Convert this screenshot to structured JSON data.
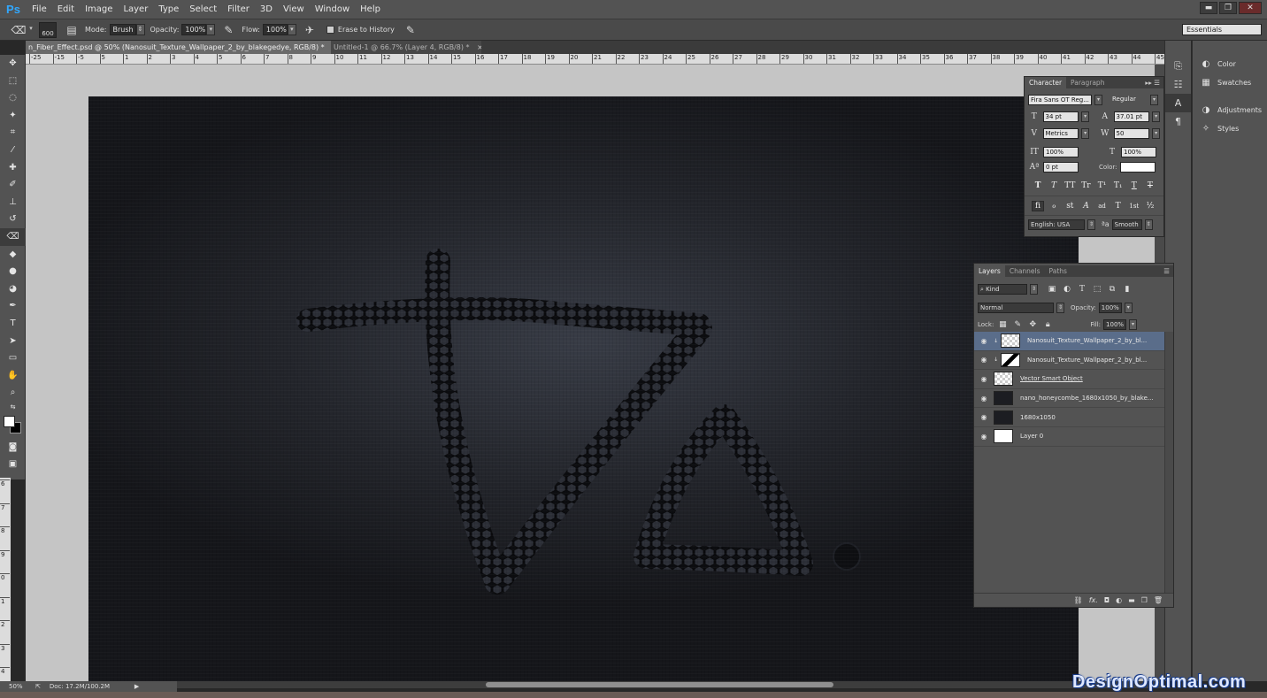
{
  "app": {
    "logo": "Ps"
  },
  "menu": [
    "File",
    "Edit",
    "Image",
    "Layer",
    "Type",
    "Select",
    "Filter",
    "3D",
    "View",
    "Window",
    "Help"
  ],
  "window_buttons": {
    "minimize": "▬",
    "restore": "❐",
    "close": "✕"
  },
  "options": {
    "brush_size": "600",
    "mode_label": "Mode:",
    "mode_value": "Brush",
    "opacity_label": "Opacity:",
    "opacity_value": "100%",
    "flow_label": "Flow:",
    "flow_value": "100%",
    "erase_history_label": "Erase to History",
    "workspace": "Essentials"
  },
  "doc_tabs": [
    {
      "label": "n_Fiber_Effect.psd @ 50% (Nanosuit_Texture_Wallpaper_2_by_blakegedye, RGB/8) *",
      "close": "×"
    },
    {
      "label": "Untitled-1 @ 66.7% (Layer 4, RGB/8) *",
      "close": "×"
    }
  ],
  "ruler_top": [
    "-25",
    "-15",
    "-5",
    "5",
    "1",
    "2",
    "3",
    "4",
    "5",
    "6",
    "7",
    "8",
    "9",
    "10",
    "11",
    "12",
    "13",
    "14",
    "15",
    "16",
    "17",
    "18",
    "19",
    "20",
    "21",
    "22",
    "23",
    "24",
    "25",
    "26",
    "27",
    "28",
    "29",
    "30",
    "31",
    "32",
    "33",
    "34",
    "35",
    "36",
    "37",
    "38",
    "39",
    "40",
    "41",
    "42",
    "43",
    "44",
    "45"
  ],
  "ruler_left": [
    "6",
    "7",
    "8",
    "9",
    "0",
    "1",
    "2",
    "3",
    "4",
    "5"
  ],
  "status": {
    "zoom": "50%",
    "doc": "Doc: 17.2M/100.2M"
  },
  "dock_panels": [
    {
      "label": "Color",
      "icon": "color-wheel-icon"
    },
    {
      "label": "Swatches",
      "icon": "swatches-icon"
    },
    {
      "label": "Adjustments",
      "icon": "adjustments-icon"
    },
    {
      "label": "Styles",
      "icon": "styles-icon"
    }
  ],
  "character": {
    "tabs": [
      "Character",
      "Paragraph"
    ],
    "font_family": "Fira Sans OT Reg...",
    "font_style": "Regular",
    "font_size": "34 pt",
    "leading": "37.01 pt",
    "kerning": "Metrics",
    "tracking": "50",
    "vertical_scale": "100%",
    "horizontal_scale": "100%",
    "baseline_shift": "0 pt",
    "color_label": "Color:",
    "color_value": "#ffffff",
    "style_glyphs": [
      "T",
      "T",
      "TT",
      "Tr",
      "T¹",
      "T₁",
      "T",
      "T"
    ],
    "opentype_glyphs": [
      "fi",
      "ℴ",
      "st",
      "A",
      "ad",
      "T",
      "1st",
      "½"
    ],
    "language": "English: USA",
    "aa_label": "ªa",
    "antialias": "Smooth"
  },
  "layers": {
    "tabs": [
      "Layers",
      "Channels",
      "Paths"
    ],
    "filter_kind": "Kind",
    "blend_mode": "Normal",
    "opacity_label": "Opacity:",
    "opacity": "100%",
    "lock_label": "Lock:",
    "fill_label": "Fill:",
    "fill": "100%",
    "items": [
      {
        "name": "Nanosuit_Texture_Wallpaper_2_by_bl...",
        "selected": true
      },
      {
        "name": "Nanosuit_Texture_Wallpaper_2_by_bl...",
        "selected": false
      },
      {
        "name": "Vector Smart Object",
        "selected": false
      },
      {
        "name": "nano_honeycombe_1680x1050_by_blake...",
        "selected": false
      },
      {
        "name": "1680x1050",
        "selected": false
      },
      {
        "name": "Layer 0",
        "selected": false
      }
    ],
    "footer_icons": [
      "link-icon",
      "fx-icon",
      "mask-icon",
      "adjustment-layer-icon",
      "group-folder-icon",
      "new-layer-icon",
      "trash-icon"
    ]
  },
  "colors": {
    "accent_blue": "#31a8ff",
    "layer_selected": "#5a6d8a",
    "foreground": "#ffffff",
    "background": "#000000"
  },
  "watermark": "DesignOptimal.com"
}
